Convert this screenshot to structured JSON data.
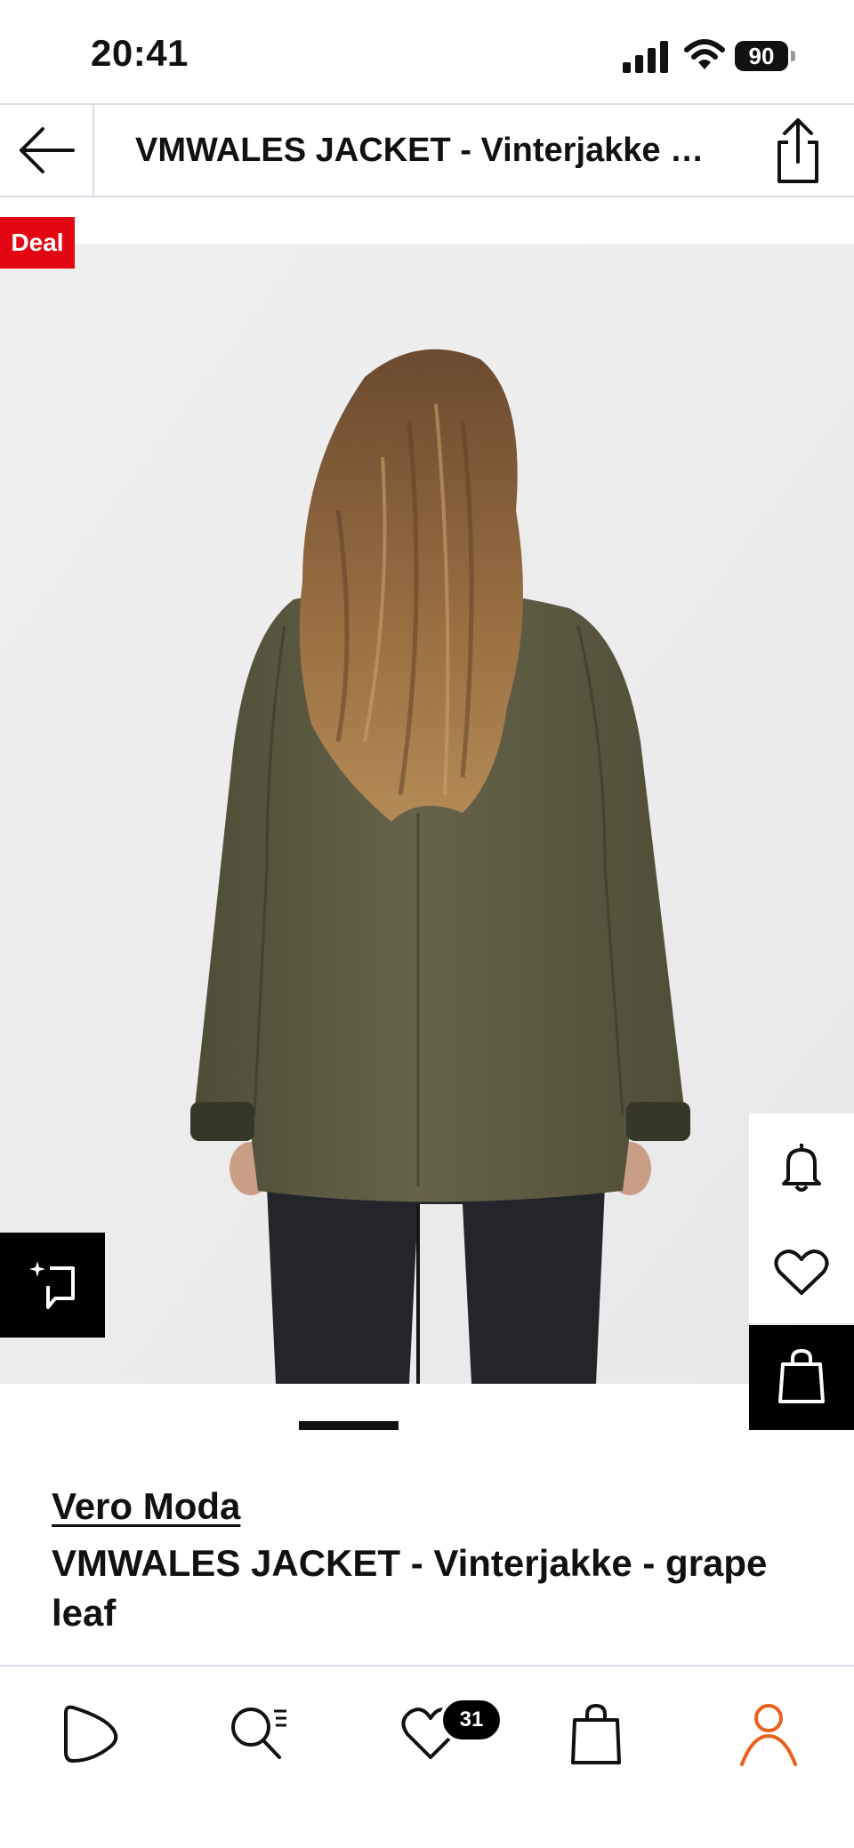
{
  "status_bar": {
    "time": "20:41",
    "battery": "90"
  },
  "top_nav": {
    "title": "VMWALES JACKET - Vinterjakke - grape leaf"
  },
  "deal_badge": "Deal",
  "product": {
    "brand": "Vero Moda",
    "name": "VMWALES JACKET - Vinterjakke - grape leaf",
    "image_index": 1
  },
  "tab_bar": {
    "wishlist_count": "31"
  },
  "colors": {
    "deal_red": "#e30613",
    "active_tab": "#e8611a",
    "jacket": "#5f5d44"
  }
}
